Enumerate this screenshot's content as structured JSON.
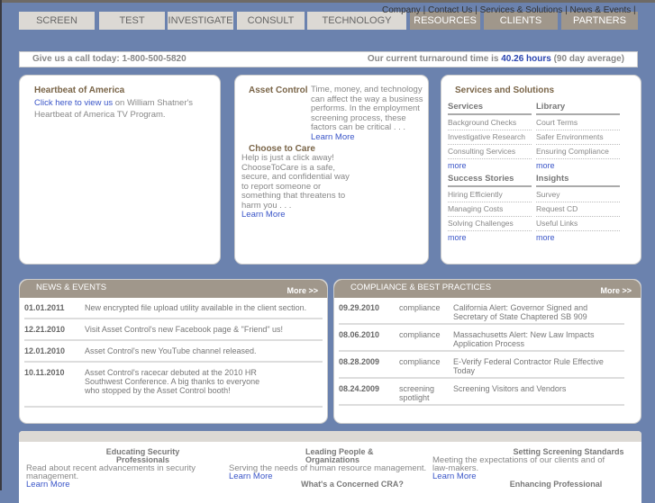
{
  "nav": [
    "SCREEN",
    "TEST",
    "INVESTIGATE",
    "CONSULT",
    "TECHNOLOGY",
    "RESOURCES",
    "CLIENTS",
    "PARTNERS"
  ],
  "top_links": [
    "Company",
    "Contact Us",
    "Services & Solutions",
    "News & Events"
  ],
  "info": {
    "call": "Give us a call today: 1-800-500-5820",
    "turn_prefix": "Our current turnaround time is ",
    "turn_value": "40.26 hours",
    "turn_suffix": " (90 day average)"
  },
  "heartbeat": {
    "title": "Heartbeat of America",
    "link": "Click here to view us",
    "text": " on William Shatner's Heartbeat of America TV Program."
  },
  "asset": {
    "title": "Asset Control",
    "text": "Time, money, and technology can affect the way a business performs. In the employment screening process, these factors can be critical . . .",
    "link": "Learn More"
  },
  "care": {
    "title": "Choose to Care",
    "text": "Help is just a click away! ChooseToCare is a safe, secure, and confidential way to report someone or something that threatens to harm you . . .",
    "link": "Learn More"
  },
  "services": {
    "title": "Services and Solutions",
    "more": "more",
    "cols": [
      {
        "head": "Services",
        "items": [
          "Background Checks",
          "Investigative Research",
          "Consulting Services"
        ]
      },
      {
        "head": "Library",
        "items": [
          "Court Terms",
          "Safer Environments",
          "Ensuring Compliance"
        ]
      },
      {
        "head": "Success Stories",
        "items": [
          "Hiring Efficiently",
          "Managing Costs",
          "Solving Challenges"
        ]
      },
      {
        "head": "Insights",
        "items": [
          "Survey",
          "Request CD",
          "Useful Links"
        ]
      }
    ]
  },
  "news": {
    "title": "NEWS & EVENTS",
    "more": "More >>",
    "rows": [
      {
        "date": "01.01.2011",
        "text": "New encrypted file upload utility available in the client section."
      },
      {
        "date": "12.21.2010",
        "text": "Visit Asset Control's new Facebook page & \"Friend\" us!"
      },
      {
        "date": "12.01.2010",
        "text": "Asset Control's new YouTube channel released."
      },
      {
        "date": "10.11.2010",
        "text": "Asset Control's racecar debuted at the 2010 HR Southwest Conference. A big thanks to everyone who stopped by the Asset Control booth!"
      }
    ]
  },
  "compliance": {
    "title": "COMPLIANCE & BEST PRACTICES",
    "more": "More >>",
    "rows": [
      {
        "date": "09.29.2010",
        "cat": "compliance",
        "text": "California Alert: Governor Signed and Secretary of State Chaptered SB 909"
      },
      {
        "date": "08.06.2010",
        "cat": "compliance",
        "text": "Massachusetts Alert: New Law Impacts Application Process"
      },
      {
        "date": "08.28.2009",
        "cat": "compliance",
        "text": "E-Verify Federal Contractor Rule Effective Today"
      },
      {
        "date": "08.24.2009",
        "cat": "screening spotlight",
        "text": "Screening Visitors and Vendors"
      }
    ]
  },
  "bottom": {
    "learn": "Learn More",
    "c1": {
      "title": "Educating Security Professionals",
      "text": "Read about recent advancements in security management."
    },
    "c2": {
      "title": "Leading People & Organizations",
      "text": "Serving the needs of human resource management.",
      "title2": "What's a Concerned CRA?"
    },
    "c3": {
      "title": "Setting Screening Standards",
      "text": "Meeting the expectations of our clients and of law-makers.",
      "title2": "Enhancing Professional"
    }
  }
}
